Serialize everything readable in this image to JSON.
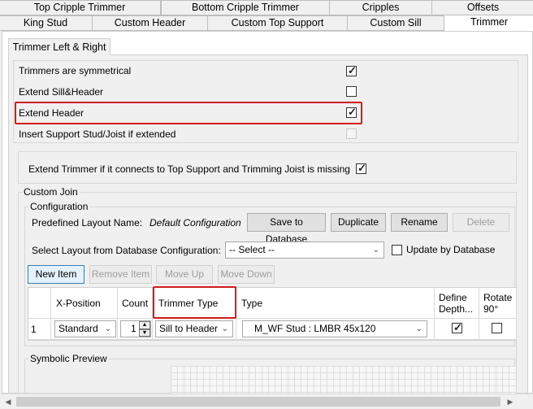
{
  "tabs_row1": [
    "Top Cripple Trimmer",
    "Bottom Cripple Trimmer",
    "Cripples",
    "Offsets"
  ],
  "tabs_row2": [
    "King Stud",
    "Custom Header",
    "Custom Top Support",
    "Custom Sill",
    "Trimmer"
  ],
  "subtab": "Trimmer Left & Right",
  "options": {
    "symmetrical": "Trimmers are symmetrical",
    "extend_sill_header": "Extend Sill&Header",
    "extend_header": "Extend Header",
    "insert_support": "Insert Support Stud/Joist if extended",
    "extend_trimmer": "Extend Trimmer if it connects to Top Support and Trimming Joist is missing"
  },
  "checks": {
    "symmetrical": true,
    "extend_sill_header": false,
    "extend_header": true,
    "insert_support": false,
    "extend_trimmer": true
  },
  "custom_join": {
    "legend": "Custom Join",
    "config_legend": "Configuration",
    "layout_label": "Predefined Layout Name:",
    "layout_value": "Default Configuration",
    "save_btn": "Save to Database",
    "duplicate_btn": "Duplicate",
    "rename_btn": "Rename",
    "delete_btn": "Delete",
    "select_label": "Select Layout from Database Configuration:",
    "select_value": "-- Select --",
    "update_label": "Update by Database",
    "new_btn": "New Item",
    "remove_btn": "Remove Item",
    "moveup_btn": "Move Up",
    "movedown_btn": "Move Down"
  },
  "table": {
    "headers": [
      "X-Position",
      "Count",
      "Trimmer Type",
      "Type",
      "Define Depth...",
      "Rotate 90°"
    ],
    "rows": [
      {
        "num": "1",
        "xpos": "Standard",
        "count": "1",
        "trimmer_type": "Sill to Header",
        "type": "M_WF Stud : LMBR 45x120",
        "define_depth": true,
        "rotate": false
      }
    ]
  },
  "symbolic_legend": "Symbolic Preview",
  "icons": {
    "dropdown": "chevron-down-icon",
    "spin_up": "arrow-up-icon",
    "spin_down": "arrow-down-icon",
    "check": "check-icon"
  },
  "colors": {
    "highlight": "#d21c1c",
    "focus": "#3c7fb1"
  }
}
